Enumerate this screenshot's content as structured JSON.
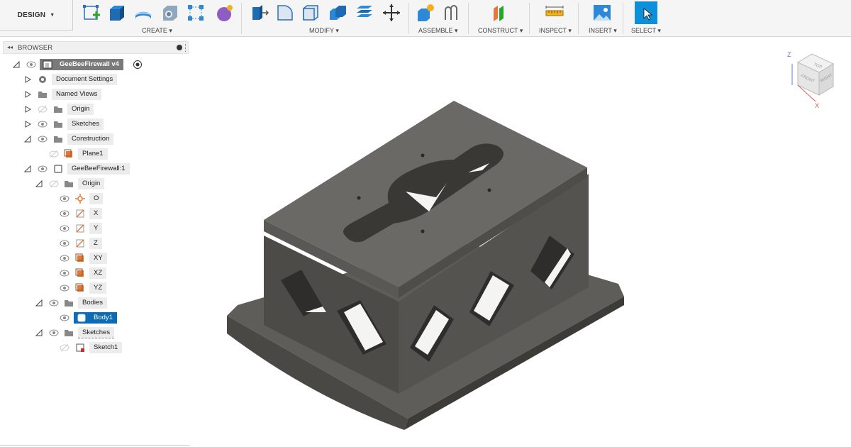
{
  "toolbar": {
    "workspace": "DESIGN",
    "groups": [
      {
        "label": "CREATE"
      },
      {
        "label": "MODIFY"
      },
      {
        "label": "ASSEMBLE"
      },
      {
        "label": "CONSTRUCT"
      },
      {
        "label": "INSPECT"
      },
      {
        "label": "INSERT"
      },
      {
        "label": "SELECT"
      }
    ]
  },
  "browser": {
    "title": "BROWSER",
    "items": [
      {
        "label": "GeeBeeFirewall v4"
      },
      {
        "label": "Document Settings"
      },
      {
        "label": "Named Views"
      },
      {
        "label": "Origin"
      },
      {
        "label": "Sketches"
      },
      {
        "label": "Construction"
      },
      {
        "label": "Plane1"
      },
      {
        "label": "GeeBeeFirewall:1"
      },
      {
        "label": "Origin"
      },
      {
        "label": "O"
      },
      {
        "label": "X"
      },
      {
        "label": "Y"
      },
      {
        "label": "Z"
      },
      {
        "label": "XY"
      },
      {
        "label": "XZ"
      },
      {
        "label": "YZ"
      },
      {
        "label": "Bodies"
      },
      {
        "label": "Body1"
      },
      {
        "label": "Sketches"
      },
      {
        "label": "Sketch1"
      }
    ]
  },
  "viewcube": {
    "faces": [
      "TOP",
      "FRONT",
      "RIGHT"
    ],
    "axes": [
      "Z",
      "X"
    ]
  },
  "colors": {
    "selected": "#0d6bb5",
    "model_top": "#6b6965",
    "model_side": "#4d4b47",
    "base_top": "#5f5d59",
    "accent_orange": "#e07a3a"
  }
}
